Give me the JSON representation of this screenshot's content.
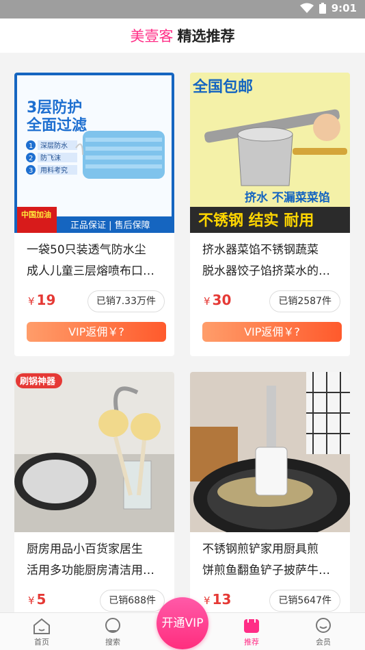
{
  "status_bar": {
    "time": "9:01"
  },
  "header": {
    "brand": "美壹客",
    "title": "精选推荐"
  },
  "products": [
    {
      "image_text": {
        "title": "3层防护",
        "subtitle": "全面过滤",
        "features": [
          "深层防水",
          "防飞沫",
          "用料考究"
        ],
        "badge": "中国加油",
        "footer": "正品保证 | 售后保障"
      },
      "title_line1": "一袋50只装透气防水尘",
      "title_line2": "成人儿童三层熔喷布口…",
      "price": "19",
      "currency": "¥",
      "sold": "已销7.33万件",
      "vip": "VIP返佣￥?"
    },
    {
      "image_text": {
        "top": "全国包邮",
        "middle": "挤水 不漏菜菜馅",
        "bottom": "不锈钢 结实 耐用"
      },
      "title_line1": "挤水器菜馅不锈钢蔬菜",
      "title_line2": "脱水器饺子馅挤菜水的…",
      "price": "30",
      "currency": "¥",
      "sold": "已销2587件",
      "vip": "VIP返佣￥?"
    },
    {
      "image_text": {
        "badge": "刷锅神器"
      },
      "title_line1": "厨房用品小百货家居生",
      "title_line2": "活用多功能厨房清洁用…",
      "price": "5",
      "currency": "¥",
      "sold": "已销688件"
    },
    {
      "title_line1": "不锈钢煎铲家用厨具煎",
      "title_line2": "饼煎鱼翻鱼铲子披萨牛…",
      "price": "13",
      "currency": "¥",
      "sold": "已销5647件"
    }
  ],
  "tabbar": {
    "home": "首页",
    "search": "搜索",
    "vip": "开通VIP",
    "recommend": "推荐",
    "member": "会员"
  },
  "colors": {
    "accent": "#ff2d86",
    "price": "#e53935",
    "vip_start": "#ff9d6a",
    "vip_end": "#ff5a2c"
  }
}
